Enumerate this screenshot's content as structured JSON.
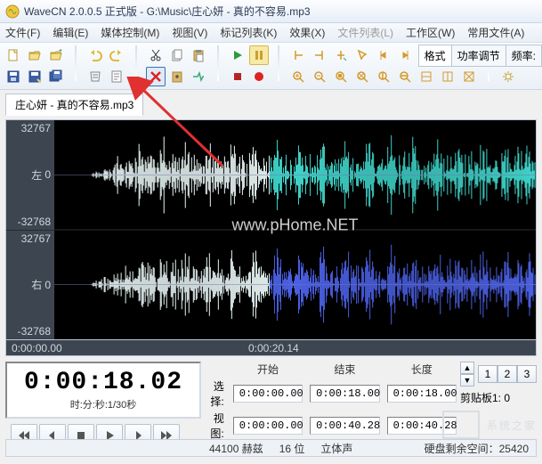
{
  "title": "WaveCN 2.0.0.5 正式版 - G:\\Music\\庄心妍 - 真的不容易.mp3",
  "menu": {
    "file": "文件(F)",
    "edit": "编辑(E)",
    "mediactl": "媒体控制(M)",
    "view": "视图(V)",
    "marklist": "标记列表(K)",
    "effects": "效果(X)",
    "filelist": "文件列表(L)",
    "workspace": "工作区(W)",
    "common": "常用文件(A)"
  },
  "doc_tab": "庄心妍 - 真的不容易.mp3",
  "side_tabs": {
    "format": "格式",
    "power": "功率调节",
    "freq": "频率:"
  },
  "gutter": {
    "max": "32767",
    "min": "-32768",
    "left": "左",
    "right": "右",
    "zero": "0"
  },
  "ruler": {
    "t0": "0:00:00.00",
    "t1": "0:00:20.14"
  },
  "timebox": {
    "time": "0:00:18.02",
    "sub": "时:分:秒:1/30秒"
  },
  "range": {
    "hd_start": "开始",
    "hd_end": "结束",
    "hd_len": "长度",
    "lb_sel": "选择:",
    "lb_view": "视图:",
    "sel_start": "0:00:00.00",
    "sel_end": "0:00:18.00",
    "sel_len": "0:00:18.00",
    "view_start": "0:00:00.00",
    "view_end": "0:00:40.28",
    "view_len": "0:00:40.28"
  },
  "pages": {
    "p1": "1",
    "p2": "2",
    "p3": "3"
  },
  "clip": "剪贴板1: 0",
  "status": {
    "hz": "44100 赫兹",
    "bit": "16 位",
    "stereo": "立体声",
    "disk": "硬盘剩余空间：25420"
  },
  "watermark": "www.pHome.NET",
  "corner": "系统之家"
}
